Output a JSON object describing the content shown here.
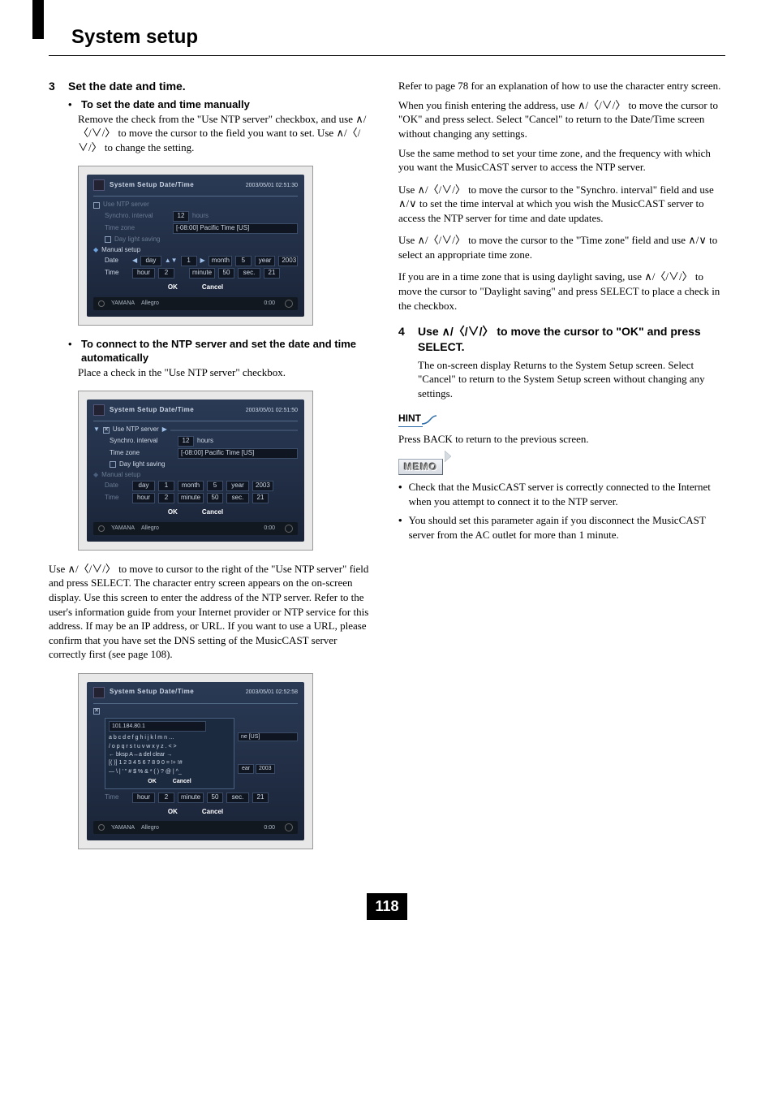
{
  "page": {
    "title": "System setup",
    "number": "118"
  },
  "left": {
    "step3": {
      "num": "3",
      "title": "Set the date and time.",
      "manual": {
        "heading": "To set the date and time manually",
        "body": "Remove the check from the \"Use NTP server\" checkbox, and use ∧/〈/∨/〉 to move the cursor to the field you want to set. Use ∧/〈/∨/〉 to change the setting."
      },
      "ntp": {
        "heading": "To connect to the NTP server and set the date and time automatically",
        "body1": "Place a check in the \"Use NTP server\" checkbox.",
        "body2": "Use ∧/〈/∨/〉 to move to cursor to the right of the \"Use NTP server\" field and press SELECT. The character entry screen appears on the on-screen display. Use this screen to enter the address of the NTP server. Refer to the user's information guide from your Internet provider or NTP service for this address. If may be an IP address, or URL. If you want to use a URL, please confirm that you have set the DNS setting of the MusicCAST server correctly first (see page 108)."
      }
    }
  },
  "right": {
    "p1": "Refer to page 78 for an explanation of how to use the character entry screen.",
    "p2": "When you finish entering the address, use ∧/〈/∨/〉 to move the cursor to \"OK\" and press select. Select \"Cancel\" to return to the Date/Time screen without changing any settings.",
    "p3": "Use the same method to set your time zone, and the frequency with which you want the MusicCAST server to access the NTP server.",
    "p4": "Use ∧/〈/∨/〉 to move the cursor to the \"Synchro. interval\" field and use ∧/∨ to set the time interval at which you wish the MusicCAST server to access the NTP server for time and date updates.",
    "p5": "Use ∧/〈/∨/〉 to move the cursor to the \"Time zone\" field and use ∧/∨ to select an appropriate time zone.",
    "p6": "If you are in a time zone that is using daylight saving, use ∧/〈/∨/〉 to move the cursor to \"Daylight saving\" and press SELECT to place a check in the checkbox.",
    "step4": {
      "num": "4",
      "title": "Use ∧/〈/∨/〉 to move the cursor to \"OK\" and press SELECT.",
      "body": "The on-screen display Returns to the System Setup screen. Select \"Cancel\" to return to the System Setup screen without changing any settings."
    },
    "hint": {
      "label": "HINT",
      "body": "Press BACK to return to the previous screen."
    },
    "memo": {
      "label": "MEMO",
      "items": [
        "Check that the MusicCAST server is correctly connected to the Internet when you attempt to connect it to the NTP server.",
        "You should set this parameter again if you disconnect the MusicCAST server from the AC outlet for more than 1 minute."
      ]
    }
  },
  "screens": {
    "common": {
      "breadcrumb": "System Setup   Date/Time",
      "use_ntp": "Use NTP server",
      "synchro": "Synchro. interval",
      "hours_val": "12",
      "hours_lbl": "hours",
      "tz_label": "Time zone",
      "tz_value": "[-08:00] Pacific Time [US]",
      "daylight": "Day light saving",
      "manual_setup": "Manual setup",
      "date": "Date",
      "time": "Time",
      "day": "day",
      "month": "month",
      "year": "year",
      "hour": "hour",
      "minute": "minute",
      "sec": "sec.",
      "d1": "1",
      "d5": "5",
      "d2003": "2003",
      "h2": "2",
      "m50": "50",
      "s21": "21",
      "ok": "OK",
      "cancel": "Cancel",
      "foot_brand": "YAMANA",
      "foot_track": "Allegro",
      "foot_time": "0:00"
    },
    "s1": {
      "timestamp": "2003/05/01    02:51:30"
    },
    "s2": {
      "timestamp": "2003/05/01    02:51:50"
    },
    "s3": {
      "timestamp": "2003/05/01    02:52:58",
      "address": "101.184.80.1",
      "row1": "a b c d e f g h i j k l m n …",
      "row2": "/ o p q r s t u v w x y z . < >",
      "row3": "← bksp A↔a                       del  clear →",
      "row4": "[( )] 1 2 3 4 5 6 7 8 9 0 = !+ !#",
      "row5": "— \\ | ' \" # $ % & * ( ) ? @ | ^_",
      "ne_us": "ne [US]",
      "ear": "ear",
      "year": "2003"
    }
  }
}
